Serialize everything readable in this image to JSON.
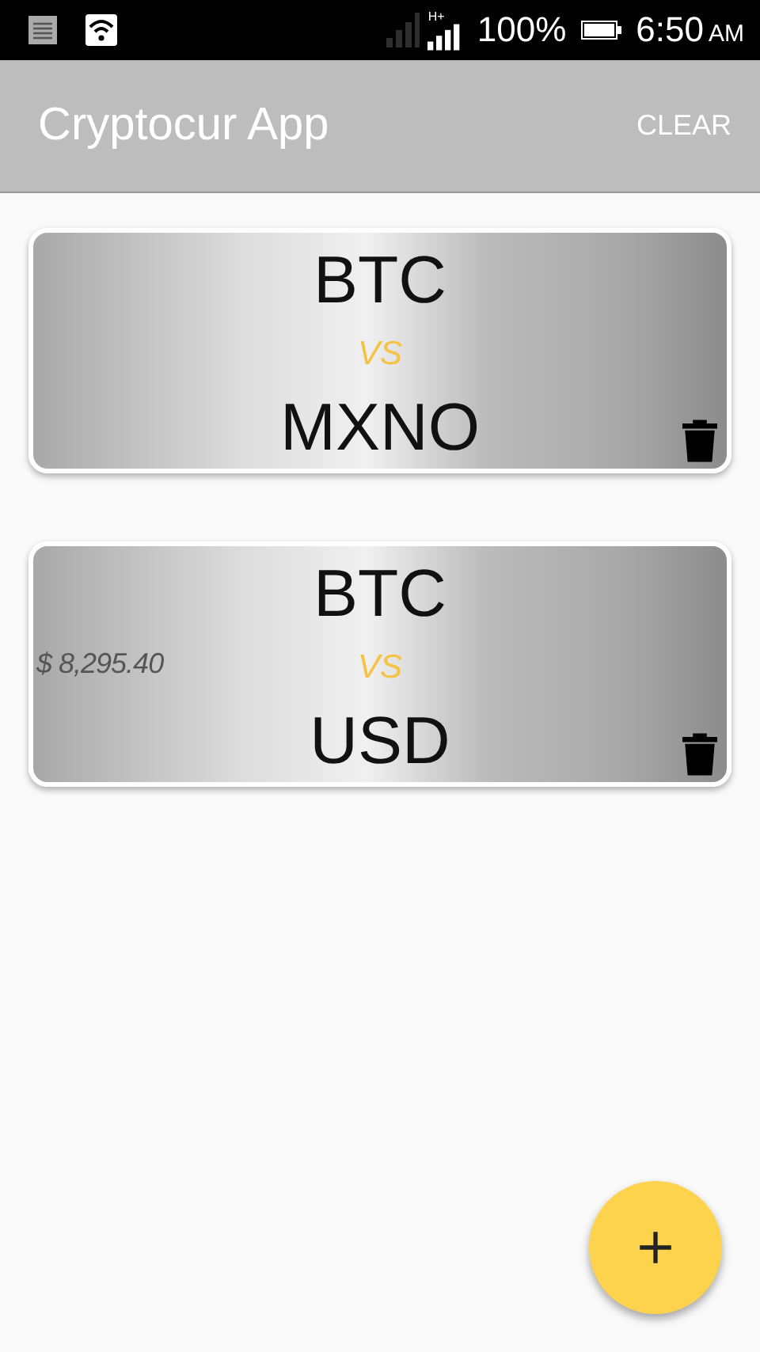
{
  "status_bar": {
    "network_type": "H+",
    "battery": "100%",
    "time": "6:50",
    "meridiem": "AM"
  },
  "app_bar": {
    "title": "Cryptocur App",
    "action": "CLEAR"
  },
  "pairs": [
    {
      "base": "BTC",
      "separator": "VS",
      "quote": "MXNO"
    },
    {
      "base": "BTC",
      "separator": "VS",
      "quote": "USD",
      "price": "$ 8,295.40"
    }
  ]
}
